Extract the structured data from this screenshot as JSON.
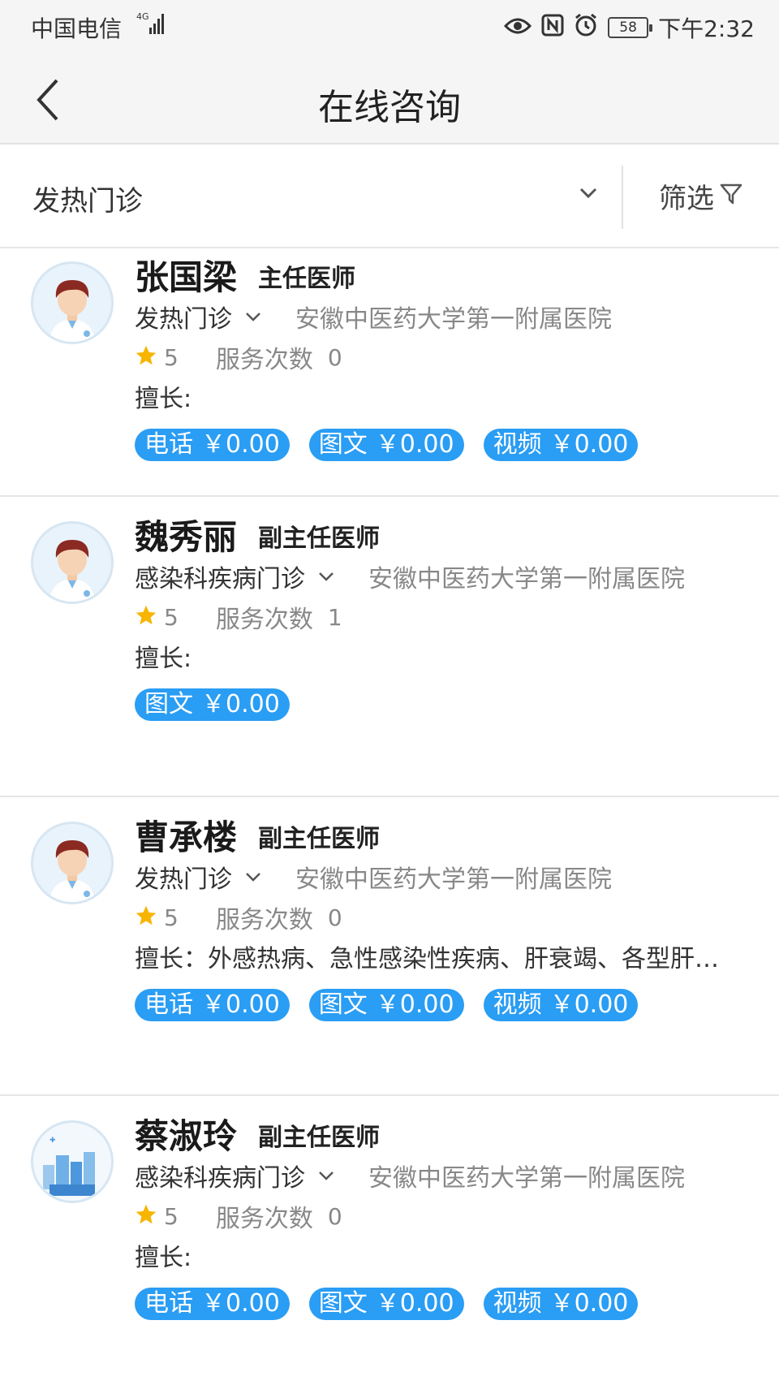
{
  "status_bar": {
    "carrier": "中国电信",
    "network": "4G",
    "battery": "58",
    "time": "下午2:32"
  },
  "header": {
    "title": "在线咨询"
  },
  "filter": {
    "department": "发热门诊",
    "filter_label": "筛选"
  },
  "doctors": [
    {
      "name": "张国梁",
      "title": "主任医师",
      "department": "发热门诊",
      "hospital": "安徽中医药大学第一附属医院",
      "rating": "5",
      "service_label": "服务次数",
      "service_count": "0",
      "specialty": "擅长:",
      "prices": [
        {
          "type": "电话",
          "price": "￥0.00"
        },
        {
          "type": "图文",
          "price": "￥0.00"
        },
        {
          "type": "视频",
          "price": "￥0.00"
        }
      ]
    },
    {
      "name": "魏秀丽",
      "title": "副主任医师",
      "department": "感染科疾病门诊",
      "hospital": "安徽中医药大学第一附属医院",
      "rating": "5",
      "service_label": "服务次数",
      "service_count": "1",
      "specialty": "擅长:",
      "prices": [
        {
          "type": "图文",
          "price": "￥0.00"
        }
      ]
    },
    {
      "name": "曹承楼",
      "title": "副主任医师",
      "department": "发热门诊",
      "hospital": "安徽中医药大学第一附属医院",
      "rating": "5",
      "service_label": "服务次数",
      "service_count": "0",
      "specialty": "擅长：外感热病、急性感染性疾病、肝衰竭、各型肝…",
      "prices": [
        {
          "type": "电话",
          "price": "￥0.00"
        },
        {
          "type": "图文",
          "price": "￥0.00"
        },
        {
          "type": "视频",
          "price": "￥0.00"
        }
      ]
    },
    {
      "name": "蔡淑玲",
      "title": "副主任医师",
      "department": "感染科疾病门诊",
      "hospital": "安徽中医药大学第一附属医院",
      "rating": "5",
      "service_label": "服务次数",
      "service_count": "0",
      "specialty": "擅长:",
      "prices": [
        {
          "type": "电话",
          "price": "￥0.00"
        },
        {
          "type": "图文",
          "price": "￥0.00"
        },
        {
          "type": "视频",
          "price": "￥0.00"
        }
      ]
    }
  ]
}
